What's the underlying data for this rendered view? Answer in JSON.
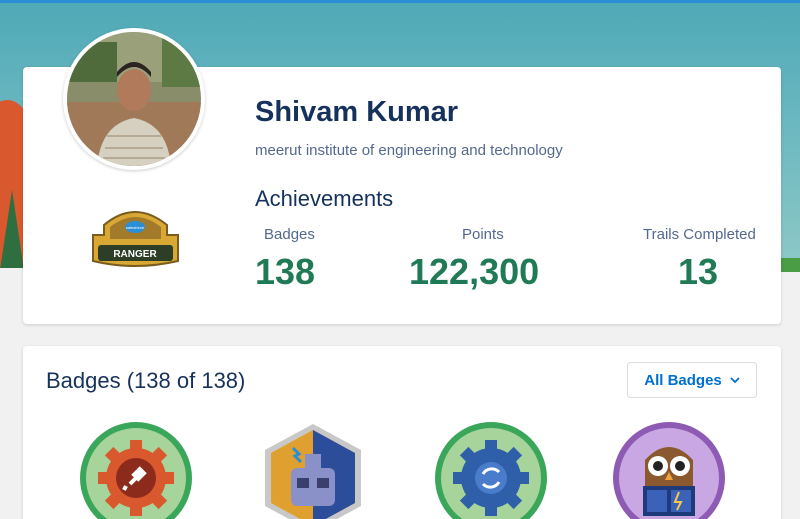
{
  "profile": {
    "name": "Shivam Kumar",
    "school": "meerut institute of engineering and technology",
    "rank_brand": "salesforce",
    "rank_label": "RANGER"
  },
  "achievements": {
    "title": "Achievements",
    "stats": [
      {
        "label": "Badges",
        "value": "138"
      },
      {
        "label": "Points",
        "value": "122,300"
      },
      {
        "label": "Trails Completed",
        "value": "13"
      }
    ]
  },
  "badges_section": {
    "title": "Badges (138 of 138)",
    "filter_label": "All Badges",
    "badges": [
      {
        "icon": "plug-gear-badge-icon",
        "color": "#d9582d"
      },
      {
        "icon": "robot-hex-badge-icon",
        "color": "#5b6fa9"
      },
      {
        "icon": "sync-gear-badge-icon",
        "color": "#2f5fa8"
      },
      {
        "icon": "owl-badge-icon",
        "color": "#8e5bb4"
      }
    ]
  },
  "colors": {
    "accent": "#0070d2",
    "stat_value": "#1f7a55",
    "heading": "#16325c",
    "muted": "#54698d"
  }
}
